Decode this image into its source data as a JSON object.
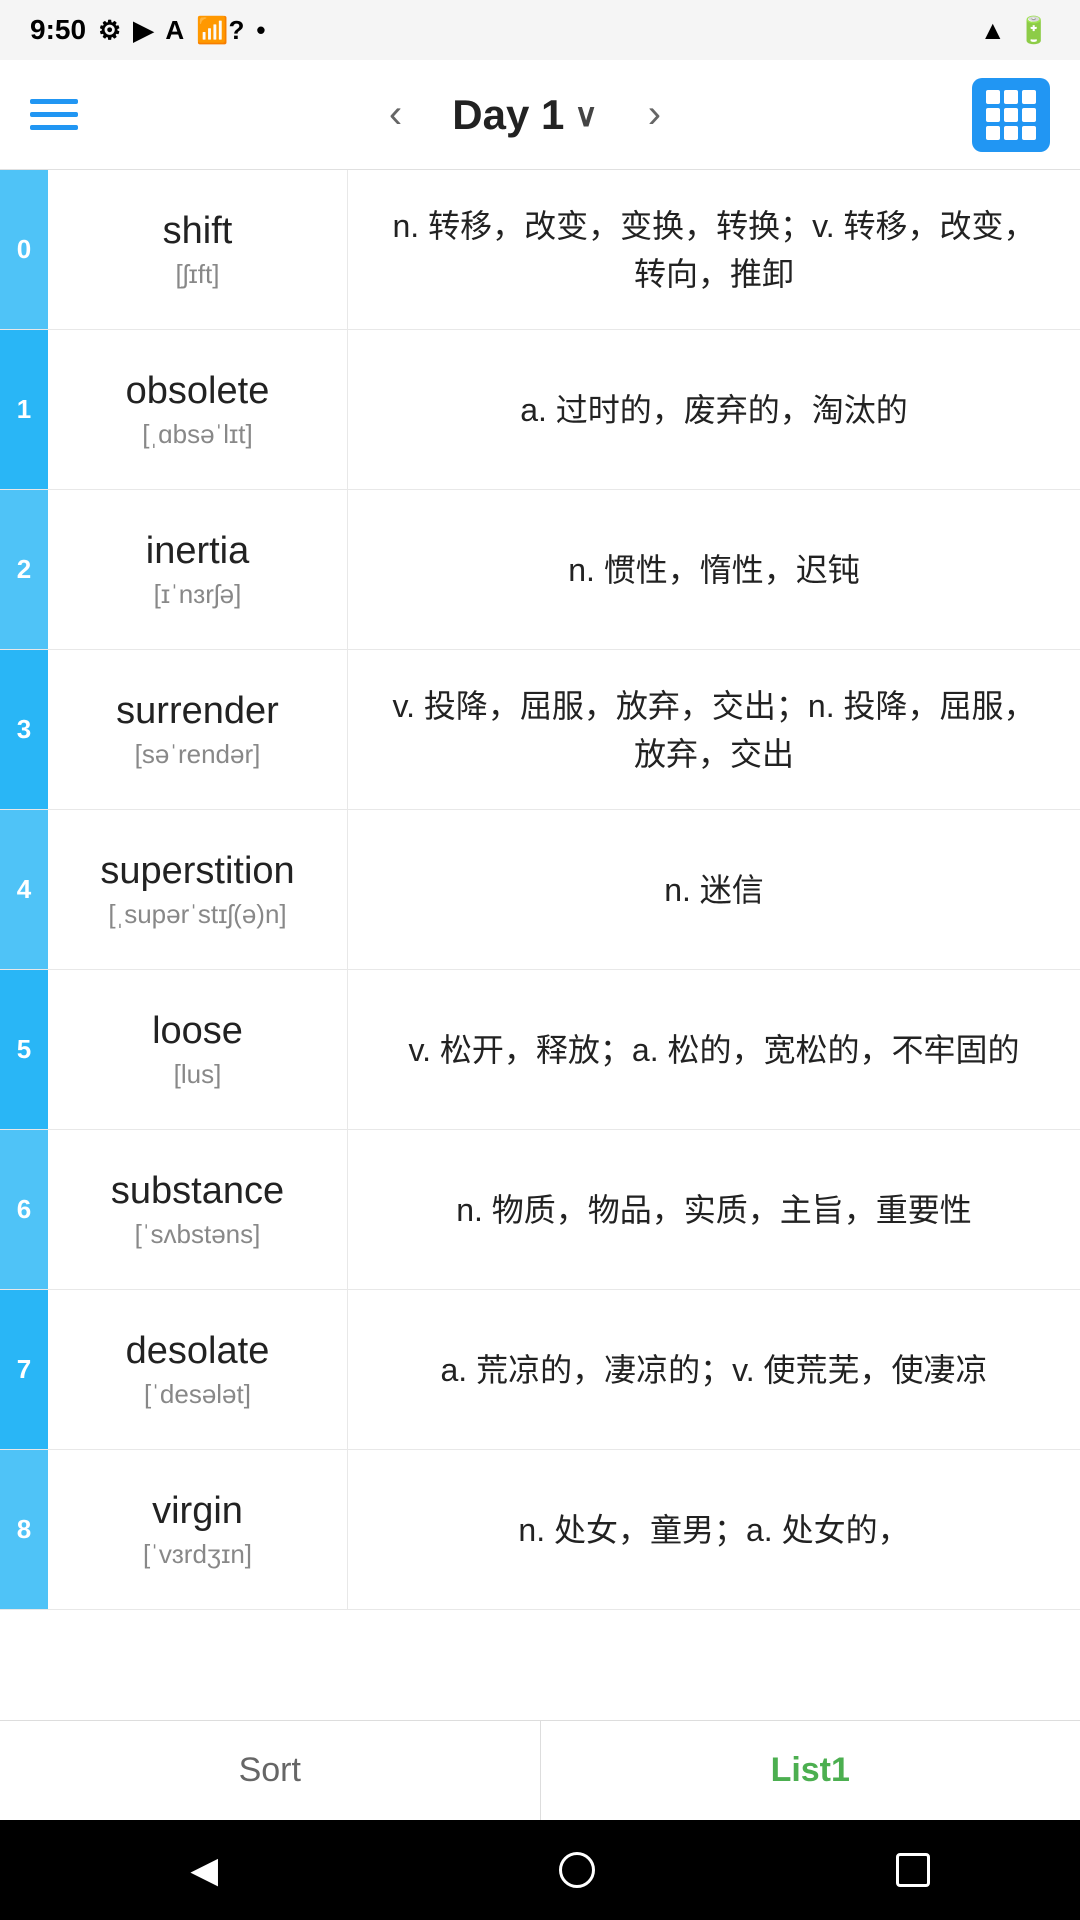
{
  "statusBar": {
    "time": "9:50",
    "icons": [
      "gear",
      "play-protection",
      "font",
      "wifi-question",
      "dot",
      "signal",
      "battery"
    ]
  },
  "header": {
    "title": "Day 1",
    "prevLabel": "‹",
    "nextLabel": "›"
  },
  "words": [
    {
      "index": "0",
      "english": "shift",
      "phonetic": "[ʃɪft]",
      "definition": "n. 转移，改变，变换，转换；v. 转移，改变，转向，推卸"
    },
    {
      "index": "1",
      "english": "obsolete",
      "phonetic": "[ˌɑbsəˈlɪt]",
      "definition": "a. 过时的，废弃的，淘汰的"
    },
    {
      "index": "2",
      "english": "inertia",
      "phonetic": "[ɪˈnɜrʃə]",
      "definition": "n. 惯性，惰性，迟钝"
    },
    {
      "index": "3",
      "english": "surrender",
      "phonetic": "[səˈrendər]",
      "definition": "v. 投降，屈服，放弃，交出；n. 投降，屈服，放弃，交出"
    },
    {
      "index": "4",
      "english": "superstition",
      "phonetic": "[ˌsupərˈstɪʃ(ə)n]",
      "definition": "n. 迷信"
    },
    {
      "index": "5",
      "english": "loose",
      "phonetic": "[lus]",
      "definition": "v. 松开，释放；a. 松的，宽松的，不牢固的"
    },
    {
      "index": "6",
      "english": "substance",
      "phonetic": "[ˈsʌbstəns]",
      "definition": "n. 物质，物品，实质，主旨，重要性"
    },
    {
      "index": "7",
      "english": "desolate",
      "phonetic": "[ˈdesələt]",
      "definition": "a. 荒凉的，凄凉的；v. 使荒芜，使凄凉"
    },
    {
      "index": "8",
      "english": "virgin",
      "phonetic": "[ˈvɜrdʒɪn]",
      "definition": "n. 处女，童男；a. 处女的，"
    }
  ],
  "bottomTabs": {
    "sort": "Sort",
    "list1": "List1"
  },
  "navBar": {
    "back": "◀",
    "home": "●",
    "recent": "■"
  }
}
